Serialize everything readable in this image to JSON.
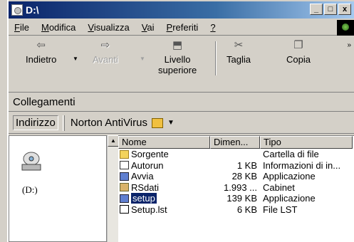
{
  "window": {
    "title": "D:\\"
  },
  "caption_buttons": {
    "minimize": "_",
    "maximize": "□",
    "close": "x"
  },
  "menu": [
    {
      "label": "File",
      "accel": "F",
      "rest": "ile"
    },
    {
      "label": "Modifica",
      "accel": "M",
      "rest": "odifica"
    },
    {
      "label": "Visualizza",
      "accel": "V",
      "rest": "isualizza"
    },
    {
      "label": "Vai",
      "accel": "V",
      "rest": "ai"
    },
    {
      "label": "Preferiti",
      "accel": "P",
      "rest": "referiti"
    },
    {
      "label": "?",
      "accel": "?",
      "rest": ""
    }
  ],
  "toolbar": {
    "back": "Indietro",
    "forward": "Avanti",
    "up_line1": "Livello",
    "up_line2": "superiore",
    "cut": "Taglia",
    "copy": "Copia",
    "more": "»"
  },
  "links_bar": {
    "label": "Collegamenti"
  },
  "address_bar": {
    "label": "Indirizzo",
    "norton": "Norton AntiVirus"
  },
  "left_pane": {
    "drive_label": "(D:)"
  },
  "list": {
    "headers": {
      "name": "Nome",
      "size": "Dimen...",
      "type": "Tipo"
    },
    "rows": [
      {
        "name": "Sorgente",
        "size": "",
        "type": "Cartella di file",
        "icon": "folder-icon"
      },
      {
        "name": "Autorun",
        "size": "1 KB",
        "type": "Informazioni di in...",
        "icon": "inf-file-icon"
      },
      {
        "name": "Avvia",
        "size": "28 KB",
        "type": "Applicazione",
        "icon": "app-icon"
      },
      {
        "name": "RSdati",
        "size": "1.993 ...",
        "type": "Cabinet",
        "icon": "cabinet-icon"
      },
      {
        "name": "setup",
        "size": "139 KB",
        "type": "Applicazione",
        "icon": "setup-icon",
        "selected": true
      },
      {
        "name": "Setup.lst",
        "size": "6 KB",
        "type": "File LST",
        "icon": "lst-file-icon"
      }
    ]
  },
  "colors": {
    "titlebar": "#0a246a",
    "selection": "#0a246a",
    "face": "#d4d0c8"
  }
}
